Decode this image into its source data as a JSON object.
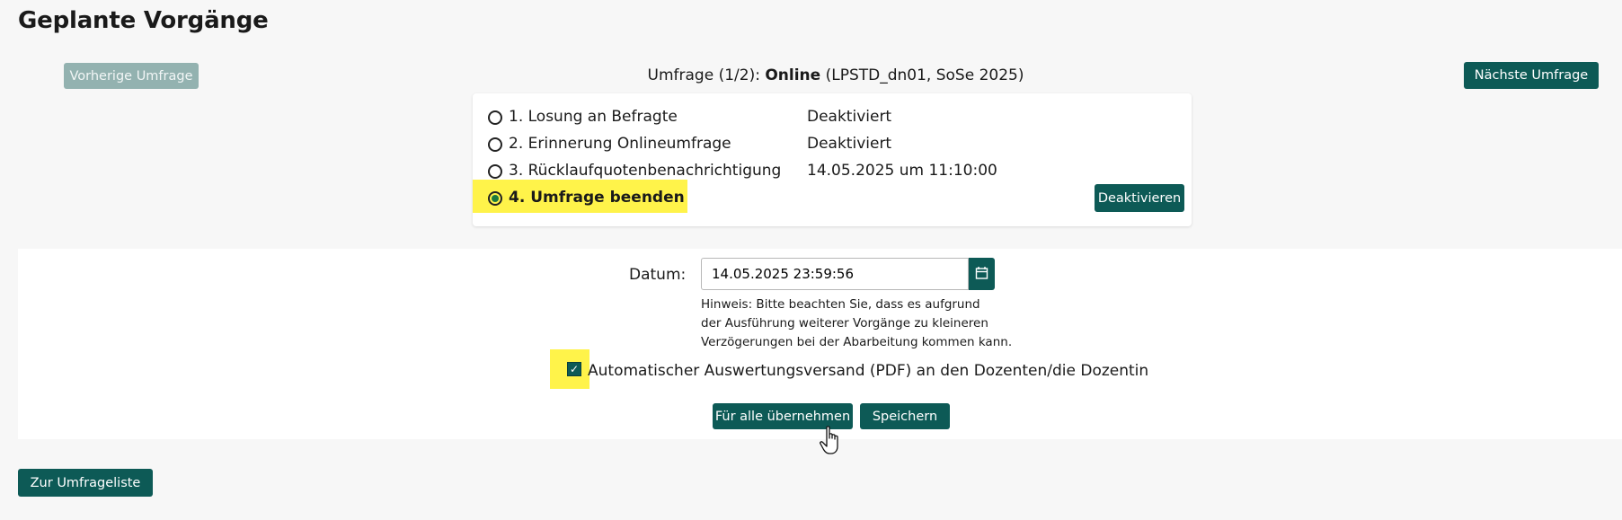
{
  "page": {
    "title": "Geplante Vorgänge"
  },
  "nav": {
    "prev_label": "Vorherige Umfrage",
    "next_label": "Nächste Umfrage"
  },
  "survey": {
    "prefix": "Umfrage (1/2):",
    "status": "Online",
    "suffix": "(LPSTD_dn01, SoSe 2025)"
  },
  "processes": [
    {
      "label": "1. Losung an Befragte",
      "value": "Deaktiviert",
      "selected": false
    },
    {
      "label": "2. Erinnerung Onlineumfrage",
      "value": "Deaktiviert",
      "selected": false
    },
    {
      "label": "3. Rücklaufquotenbenachrichtigung",
      "value": "14.05.2025 um 11:10:00",
      "selected": false
    },
    {
      "label": "4. Umfrage beenden",
      "value": "",
      "selected": true
    }
  ],
  "card": {
    "deactivate_label": "Deaktivieren"
  },
  "form": {
    "date_label": "Datum:",
    "date_value": "14.05.2025 23:59:56",
    "hint_lines": [
      "Hinweis: Bitte beachten Sie, dass es aufgrund",
      "der Ausführung weiterer Vorgänge zu kleineren",
      "Verzögerungen bei der Abarbeitung kommen kann."
    ],
    "checkbox_label": "Automatischer Auswertungsversand (PDF) an den Dozenten/die Dozentin",
    "checkbox_checked": true,
    "apply_all_label": "Für alle übernehmen",
    "save_label": "Speichern"
  },
  "footer": {
    "back_label": "Zur Umfrageliste"
  },
  "colors": {
    "primary": "#0d5a56",
    "disabled": "#93b2b0",
    "highlight": "#fff34a"
  },
  "icons": [
    "calendar-icon",
    "hand-pointer-icon",
    "check-icon",
    "radio-icon"
  ]
}
